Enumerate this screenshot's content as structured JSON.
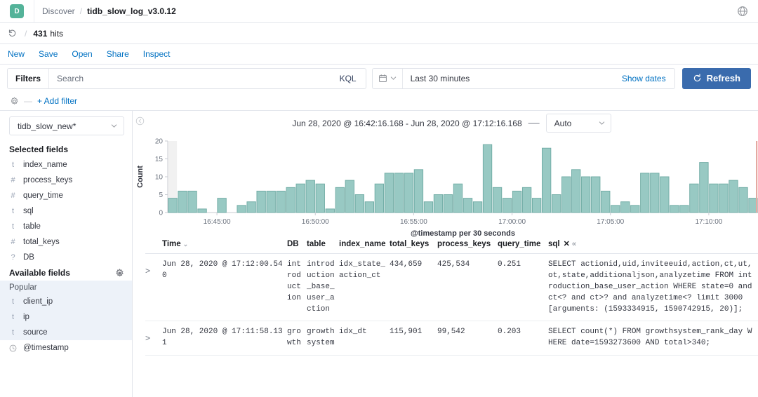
{
  "header": {
    "logo_letter": "D",
    "breadcrumb_app": "Discover",
    "breadcrumb_sep": "/",
    "breadcrumb_current": "tidb_slow_log_v3.0.12",
    "globe_icon": "globe-icon"
  },
  "hitsbar": {
    "undo_icon": "undo-icon",
    "separator": "/",
    "hits_count": "431",
    "hits_label": "hits"
  },
  "menu": {
    "items": [
      {
        "label": "New"
      },
      {
        "label": "Save"
      },
      {
        "label": "Open"
      },
      {
        "label": "Share"
      },
      {
        "label": "Inspect"
      }
    ]
  },
  "query_bar": {
    "filters_label": "Filters",
    "search_placeholder": "Search",
    "search_value": "",
    "kql_label": "KQL",
    "calendar_icon": "calendar-icon",
    "date_value": "Last 30 minutes",
    "show_dates_label": "Show dates",
    "refresh_label": "Refresh",
    "refresh_icon": "refresh-icon",
    "accent_color": "#3a6bad",
    "link_color": "#0071c2"
  },
  "filter_bar": {
    "gear_icon": "gear-icon",
    "dash": "—",
    "add_filter_label": "+ Add filter"
  },
  "sidebar": {
    "index_pattern": "tidb_slow_new*",
    "selected_fields_heading": "Selected fields",
    "selected_fields": [
      {
        "type": "t",
        "name": "index_name"
      },
      {
        "type": "#",
        "name": "process_keys"
      },
      {
        "type": "#",
        "name": "query_time"
      },
      {
        "type": "t",
        "name": "sql"
      },
      {
        "type": "t",
        "name": "table"
      },
      {
        "type": "#",
        "name": "total_keys"
      },
      {
        "type": "?",
        "name": "DB"
      }
    ],
    "available_fields_heading": "Available fields",
    "available_gear_icon": "gear-icon",
    "popular_heading": "Popular",
    "popular_fields": [
      {
        "type": "t",
        "name": "client_ip"
      },
      {
        "type": "t",
        "name": "ip"
      },
      {
        "type": "t",
        "name": "source"
      }
    ],
    "other_fields": [
      {
        "type": "clock",
        "name": "@timestamp"
      }
    ]
  },
  "chart_header": {
    "collapse_icon": "collapse-panel-icon",
    "range_text": "Jun 28, 2020 @ 16:42:16.168 - Jun 28, 2020 @ 17:12:16.168",
    "dash": "—",
    "interval_value": "Auto"
  },
  "chart_data": {
    "type": "bar",
    "title": "",
    "xlabel": "@timestamp per 30 seconds",
    "ylabel": "Count",
    "ylim": [
      0,
      20
    ],
    "yticks": [
      0,
      5,
      10,
      15,
      20
    ],
    "grid": false,
    "bar_color": "#98c9c3",
    "bar_stroke": "#6eaaa3",
    "x_tick_labels": [
      "16:45:00",
      "16:50:00",
      "16:55:00",
      "17:00:00",
      "17:05:00",
      "17:10:00"
    ],
    "x_tick_index": [
      5,
      15,
      25,
      35,
      45,
      55
    ],
    "categories": [
      "16:42:30",
      "16:43:00",
      "16:43:30",
      "16:44:00",
      "16:44:30",
      "16:45:00",
      "16:45:30",
      "16:46:00",
      "16:46:30",
      "16:47:00",
      "16:47:30",
      "16:48:00",
      "16:48:30",
      "16:49:00",
      "16:49:30",
      "16:50:00",
      "16:50:30",
      "16:51:00",
      "16:51:30",
      "16:52:00",
      "16:52:30",
      "16:53:00",
      "16:53:30",
      "16:54:00",
      "16:54:30",
      "16:55:00",
      "16:55:30",
      "16:56:00",
      "16:56:30",
      "16:57:00",
      "16:57:30",
      "16:58:00",
      "16:58:30",
      "16:59:00",
      "16:59:30",
      "17:00:00",
      "17:00:30",
      "17:01:00",
      "17:01:30",
      "17:02:00",
      "17:02:30",
      "17:03:00",
      "17:03:30",
      "17:04:00",
      "17:04:30",
      "17:05:00",
      "17:05:30",
      "17:06:00",
      "17:06:30",
      "17:07:00",
      "17:07:30",
      "17:08:00",
      "17:08:30",
      "17:09:00",
      "17:09:30",
      "17:10:00",
      "17:10:30",
      "17:11:00",
      "17:11:30",
      "17:12:00"
    ],
    "values": [
      4,
      6,
      6,
      1,
      0,
      4,
      0,
      2,
      3,
      6,
      6,
      6,
      7,
      8,
      9,
      8,
      1,
      7,
      9,
      5,
      3,
      8,
      11,
      11,
      11,
      12,
      3,
      5,
      5,
      8,
      4,
      3,
      19,
      7,
      4,
      6,
      7,
      4,
      18,
      5,
      10,
      12,
      10,
      10,
      6,
      2,
      3,
      2,
      11,
      11,
      10,
      2,
      2,
      8,
      14,
      8,
      8,
      9,
      7,
      4
    ],
    "current_time_marker": "#e5a9a1",
    "highlight_band_color": "#e6e6e6"
  },
  "table": {
    "columns": [
      {
        "key": "expand",
        "label": ""
      },
      {
        "key": "time",
        "label": "Time",
        "sort_caret": "⌄"
      },
      {
        "key": "db",
        "label": "DB"
      },
      {
        "key": "table",
        "label": "table"
      },
      {
        "key": "index_name",
        "label": "index_name"
      },
      {
        "key": "total_keys",
        "label": "total_keys"
      },
      {
        "key": "process_keys",
        "label": "process_keys"
      },
      {
        "key": "query_time",
        "label": "query_time"
      },
      {
        "key": "sql",
        "label": "sql",
        "remove_icon": "✕",
        "collapse_icon": "«"
      }
    ],
    "rows": [
      {
        "expand": ">",
        "time": "Jun 28, 2020 @ 17:12:00.540",
        "db": "introduction",
        "table": "introduction_base_user_action",
        "index_name": "idx_state_action_ct",
        "total_keys": "434,659",
        "process_keys": "425,534",
        "query_time": "0.251",
        "sql": "SELECT actionid,uid,inviteeuid,action,ct,ut,ot,state,additionaljson,analyzetime FROM introduction_base_user_action WHERE state=0 and ct<? and ct>? and analyzetime<? limit 3000 [arguments: (1593334915, 1590742915, 20)];"
      },
      {
        "expand": ">",
        "time": "Jun 28, 2020 @ 17:11:58.131",
        "db": "growth",
        "table": "growthsystem",
        "index_name": "idx_dt",
        "total_keys": "115,901",
        "process_keys": "99,542",
        "query_time": "0.203",
        "sql": "SELECT count(*) FROM growthsystem_rank_day WHERE date=1593273600 AND total>340;"
      }
    ]
  }
}
